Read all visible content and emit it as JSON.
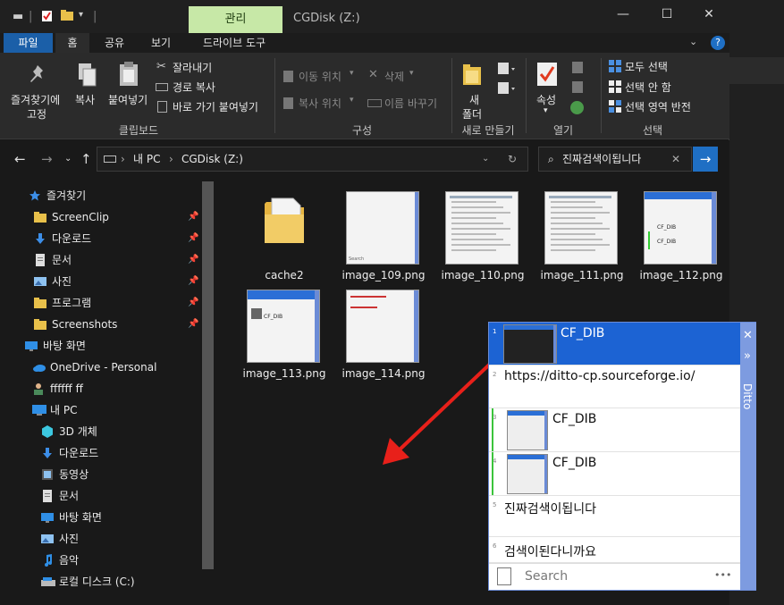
{
  "title_bar": {
    "context_tab": "관리",
    "window_title": "CGDisk (Z:)"
  },
  "ribbon_tabs": [
    "파일",
    "홈",
    "공유",
    "보기",
    "드라이브 도구"
  ],
  "ribbon": {
    "clipboard": {
      "pin_label_line1": "즐겨찾기에",
      "pin_label_line2": "고정",
      "copy": "복사",
      "paste": "붙여넣기",
      "cut": "잘라내기",
      "copy_path": "경로 복사",
      "paste_shortcut": "바로 가기 붙여넣기",
      "group": "클립보드"
    },
    "organize": {
      "move_to": "이동 위치",
      "copy_to": "복사 위치",
      "delete": "삭제",
      "rename": "이름 바꾸기",
      "group": "구성"
    },
    "new": {
      "new_folder_line1": "새",
      "new_folder_line2": "폴더",
      "group": "새로 만들기"
    },
    "open": {
      "properties": "속성",
      "group": "열기"
    },
    "select": {
      "select_all": "모두 선택",
      "select_none": "선택 안 함",
      "invert": "선택 영역 반전",
      "group": "선택"
    }
  },
  "address": {
    "path": [
      "내 PC",
      "CGDisk (Z:)"
    ],
    "search_value": "진짜검색이됩니다"
  },
  "nav_pane": {
    "items": [
      {
        "label": "즐겨찾기",
        "icon": "star-icon"
      },
      {
        "label": "ScreenClip",
        "icon": "folder-icon",
        "pinned": true
      },
      {
        "label": "다운로드",
        "icon": "download-icon",
        "pinned": true
      },
      {
        "label": "문서",
        "icon": "document-icon",
        "pinned": true
      },
      {
        "label": "사진",
        "icon": "picture-icon",
        "pinned": true
      },
      {
        "label": "프로그램",
        "icon": "folder-icon",
        "pinned": true
      },
      {
        "label": "Screenshots",
        "icon": "folder-icon",
        "pinned": true
      },
      {
        "label": "바탕 화면",
        "icon": "desktop-icon"
      },
      {
        "label": "OneDrive - Personal",
        "icon": "cloud-icon"
      },
      {
        "label": "ffffff ff",
        "icon": "user-icon"
      },
      {
        "label": "내 PC",
        "icon": "pc-icon"
      },
      {
        "label": "3D 개체",
        "icon": "cube-icon"
      },
      {
        "label": "다운로드",
        "icon": "download-icon"
      },
      {
        "label": "동영상",
        "icon": "video-icon"
      },
      {
        "label": "문서",
        "icon": "document-icon"
      },
      {
        "label": "바탕 화면",
        "icon": "desktop-icon"
      },
      {
        "label": "사진",
        "icon": "picture-icon"
      },
      {
        "label": "음악",
        "icon": "music-icon"
      },
      {
        "label": "로컬 디스크 (C:)",
        "icon": "drive-icon"
      }
    ]
  },
  "files": [
    {
      "name": "cache2",
      "type": "folder"
    },
    {
      "name": "image_109.png",
      "type": "image"
    },
    {
      "name": "image_110.png",
      "type": "image"
    },
    {
      "name": "image_111.png",
      "type": "image"
    },
    {
      "name": "image_112.png",
      "type": "image"
    },
    {
      "name": "image_113.png",
      "type": "image"
    },
    {
      "name": "image_114.png",
      "type": "image"
    }
  ],
  "thumb_text": {
    "search": "Search",
    "cf_dib": "CF_DIB"
  },
  "ditto": {
    "side_title": "Ditto",
    "clips": [
      {
        "num": "1",
        "text": "CF_DIB",
        "kind": "image"
      },
      {
        "num": "2",
        "text": "https://ditto-cp.sourceforge.io/",
        "kind": "text"
      },
      {
        "num": "3",
        "text": "CF_DIB",
        "kind": "image"
      },
      {
        "num": "4",
        "text": "CF_DIB",
        "kind": "image"
      },
      {
        "num": "5",
        "text": "진짜검색이됩니다",
        "kind": "text"
      },
      {
        "num": "6",
        "text": "검색이된다니까요",
        "kind": "text"
      }
    ],
    "search_placeholder": "Search",
    "more": "•••"
  },
  "colors": {
    "accent": "#1c63d3",
    "file_tab": "#1b5fa8",
    "context_tab": "#c7e8a7",
    "arrow": "#e8201a"
  }
}
